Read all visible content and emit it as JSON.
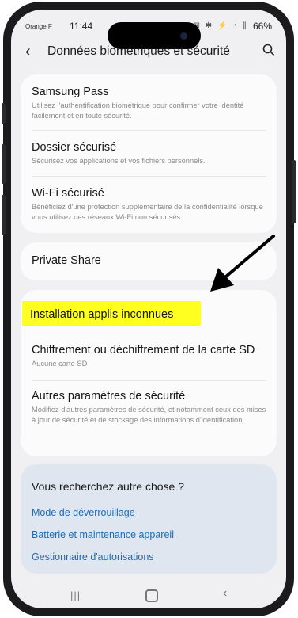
{
  "status_bar": {
    "carrier": "Orange F",
    "time": "11:44",
    "icons": "⊠ ✱ ⚡ ◔ ∥",
    "battery": "66%"
  },
  "header": {
    "title": "Données biométriques et sécurité",
    "back_icon": "‹",
    "search_icon": "search-icon"
  },
  "items": [
    {
      "title": "Samsung Pass",
      "desc": "Utilisez l'authentification biométrique pour confirmer votre identité facilement et en toute sécurité."
    },
    {
      "title": "Dossier sécurisé",
      "desc": "Sécurisez vos applications et vos fichiers personnels."
    },
    {
      "title": "Wi-Fi sécurisé",
      "desc": "Bénéficiez d'une protection supplémentaire de la confidentialité lorsque vous utilisez des réseaux Wi-Fi non sécurisés."
    },
    {
      "title": "Private Share"
    },
    {
      "title": "Installation applis inconnues"
    },
    {
      "title": "Chiffrement ou déchiffrement de la carte SD",
      "desc": "Aucune carte SD"
    },
    {
      "title": "Autres paramètres de sécurité",
      "desc": "Modifiez d'autres paramètres de sécurité, et notamment ceux des mises à jour de sécurité et de stockage des informations d'identification."
    }
  ],
  "suggestions": {
    "question": "Vous recherchez autre chose ?",
    "links": [
      "Mode de déverrouillage",
      "Batterie et maintenance appareil",
      "Gestionnaire d'autorisations"
    ]
  },
  "colors": {
    "highlight": "#ffff20",
    "link": "#1d6cb5",
    "card": "#fbfbfc",
    "background": "#f0f0f2"
  }
}
